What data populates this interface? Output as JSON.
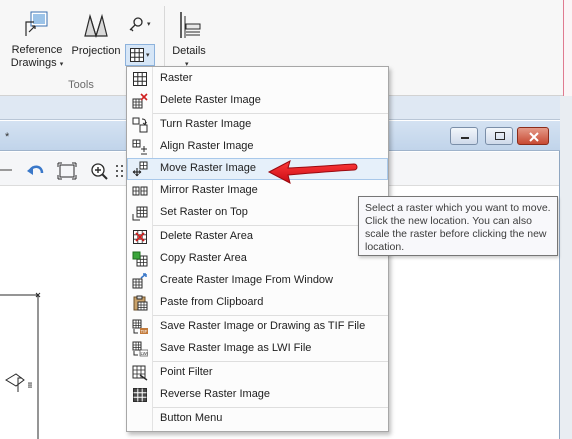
{
  "ribbon": {
    "reference_drawings_line1": "Reference",
    "reference_drawings_line2": "Drawings",
    "projection_label": "Projection",
    "details_label": "Details",
    "group_label": "Tools",
    "dropdown_arrow": "▾"
  },
  "background_window": {
    "title_fragment": "*"
  },
  "menu": {
    "items": [
      {
        "label": "Raster",
        "icon": "raster-grid-icon"
      },
      {
        "label": "Delete Raster Image",
        "icon": "delete-raster-image-icon"
      },
      {
        "label": "Turn Raster Image",
        "icon": "turn-raster-image-icon"
      },
      {
        "label": "Align Raster Image",
        "icon": "align-raster-image-icon"
      },
      {
        "label": "Move Raster Image",
        "icon": "move-raster-image-icon"
      },
      {
        "label": "Mirror Raster Image",
        "icon": "mirror-raster-image-icon"
      },
      {
        "label": "Set Raster on Top",
        "icon": "set-raster-on-top-icon"
      },
      {
        "label": "Delete Raster Area",
        "icon": "delete-raster-area-icon"
      },
      {
        "label": "Copy Raster Area",
        "icon": "copy-raster-area-icon"
      },
      {
        "label": "Create Raster Image From Window",
        "icon": "create-raster-from-window-icon"
      },
      {
        "label": "Paste from Clipboard",
        "icon": "paste-clipboard-icon"
      },
      {
        "label": "Save Raster Image or Drawing as TIF File",
        "icon": "save-tif-icon"
      },
      {
        "label": "Save Raster Image as LWI File",
        "icon": "save-lwi-icon"
      },
      {
        "label": "Point Filter",
        "icon": "point-filter-icon"
      },
      {
        "label": "Reverse Raster Image",
        "icon": "reverse-raster-image-icon"
      },
      {
        "label": "Button Menu",
        "icon": ""
      }
    ],
    "highlighted_item": "Move Raster Image"
  },
  "tooltip": {
    "text": "Select a raster which you want to move. Click the new location. You can also scale the raster before clicking the new location."
  },
  "colors": {
    "highlight_bg": "#e6f0fa",
    "highlight_border": "#a8c8ea",
    "arrow_red": "#e0141e",
    "ribbon_bg": "#f7f7f7"
  }
}
